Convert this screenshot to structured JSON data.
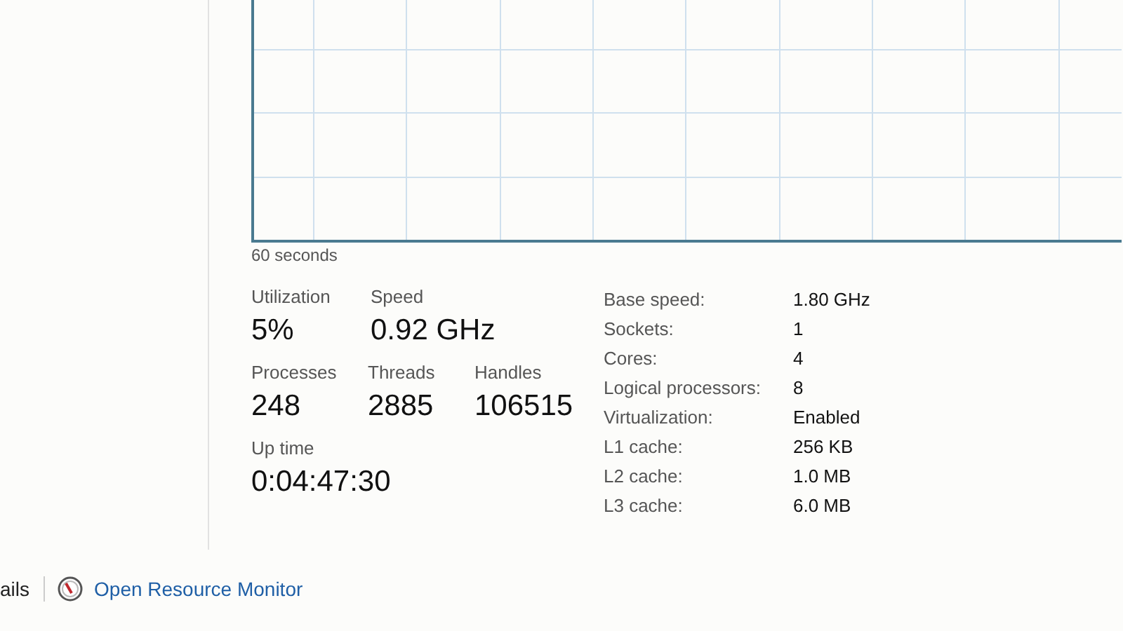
{
  "graph": {
    "time_label": "60 seconds"
  },
  "stats": [
    {
      "label": "Utilization",
      "value": "5%"
    },
    {
      "label": "Speed",
      "value": "0.92 GHz"
    },
    {
      "label": "Processes",
      "value": "248"
    },
    {
      "label": "Threads",
      "value": "2885"
    },
    {
      "label": "Handles",
      "value": "106515"
    },
    {
      "label": "Up time",
      "value": "0:04:47:30"
    }
  ],
  "details": [
    {
      "label": "Base speed:",
      "value": "1.80 GHz"
    },
    {
      "label": "Sockets:",
      "value": "1"
    },
    {
      "label": "Cores:",
      "value": "4"
    },
    {
      "label": "Logical processors:",
      "value": "8"
    },
    {
      "label": "Virtualization:",
      "value": "Enabled"
    },
    {
      "label": "L1 cache:",
      "value": "256 KB"
    },
    {
      "label": "L2 cache:",
      "value": "1.0 MB"
    },
    {
      "label": "L3 cache:",
      "value": "6.0 MB"
    }
  ],
  "footer": {
    "details_link": "ails",
    "resource_monitor_link": "Open Resource Monitor"
  }
}
